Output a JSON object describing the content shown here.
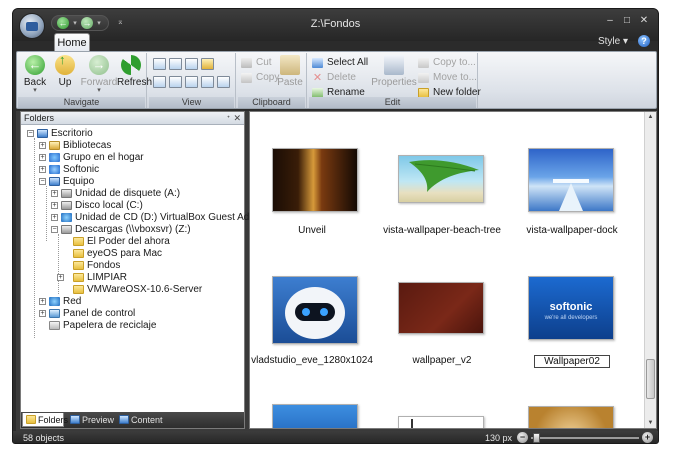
{
  "window": {
    "title": "Z:\\Fondos",
    "minimize_glyph": "‒",
    "maximize_glyph": "□",
    "close_glyph": "✕"
  },
  "qat": {
    "back_glyph": "←",
    "forward_glyph": "→",
    "more_glyph": "⌅"
  },
  "tabs": {
    "home": "Home",
    "style_menu": "Style ▾",
    "help_glyph": "?"
  },
  "ribbon": {
    "navigate": {
      "label": "Navigate",
      "back": "Back",
      "up": "Up",
      "forward": "Forward",
      "refresh": "Refresh"
    },
    "view": {
      "label": "View"
    },
    "clipboard": {
      "label": "Clipboard",
      "cut": "Cut",
      "copy": "Copy",
      "paste": "Paste"
    },
    "edit": {
      "label": "Edit",
      "select_all": "Select All",
      "delete": "Delete",
      "rename": "Rename",
      "properties": "Properties",
      "copy_to": "Copy to...",
      "move_to": "Move to...",
      "new_folder": "New folder"
    }
  },
  "folders_pane": {
    "title": "Folders",
    "pin_glyph": "ᐩ",
    "close_glyph": "✕",
    "tree": [
      {
        "label": "Escritorio",
        "icon": "desktop-icon",
        "exp": "−"
      },
      {
        "label": "Bibliotecas",
        "icon": "library-icon",
        "exp": "+"
      },
      {
        "label": "Grupo en el hogar",
        "icon": "homegroup-icon",
        "exp": "+"
      },
      {
        "label": "Softonic",
        "icon": "user-icon",
        "exp": "+"
      },
      {
        "label": "Equipo",
        "icon": "computer-icon",
        "exp": "−"
      },
      {
        "label": "Unidad de disquete (A:)",
        "icon": "floppy-icon",
        "exp": "+"
      },
      {
        "label": "Disco local (C:)",
        "icon": "drive-icon",
        "exp": "+"
      },
      {
        "label": "Unidad de CD (D:) VirtualBox Guest Additions",
        "icon": "cd-icon",
        "exp": "+"
      },
      {
        "label": "Descargas (\\\\vboxsvr) (Z:)",
        "icon": "network-drive-icon",
        "exp": "−"
      },
      {
        "label": "El Poder del ahora",
        "icon": "folder-icon",
        "exp": ""
      },
      {
        "label": "eyeOS para Mac",
        "icon": "folder-icon",
        "exp": ""
      },
      {
        "label": "Fondos",
        "icon": "folder-icon",
        "exp": ""
      },
      {
        "label": "LIMPIAR",
        "icon": "folder-icon",
        "exp": "+"
      },
      {
        "label": "VMWareOSX-10.6-Server",
        "icon": "folder-icon",
        "exp": ""
      },
      {
        "label": "Red",
        "icon": "network-icon",
        "exp": "+"
      },
      {
        "label": "Panel de control",
        "icon": "control-panel-icon",
        "exp": "+"
      },
      {
        "label": "Papelera de reciclaje",
        "icon": "recycle-bin-icon",
        "exp": ""
      }
    ],
    "tabs": {
      "folders": "Folders",
      "preview": "Preview",
      "content": "Content"
    }
  },
  "files": [
    {
      "name": "Unveil"
    },
    {
      "name": "vista-wallpaper-beach-tree"
    },
    {
      "name": "vista-wallpaper-dock"
    },
    {
      "name": "vladstudio_eve_1280x1024"
    },
    {
      "name": "wallpaper_v2"
    },
    {
      "name": "Wallpaper02",
      "renaming": true
    },
    {
      "name": ""
    },
    {
      "name": ""
    },
    {
      "name": ""
    }
  ],
  "thumbnail_art": {
    "softonic_logo": "softonic",
    "softonic_tagline": "we're all developers"
  },
  "status": {
    "objects": "58 objects",
    "zoom": "130 px",
    "zoom_out_glyph": "−",
    "zoom_in_glyph": "+",
    "zoom_level": 0.05
  },
  "colors": {
    "chrome_dark": "#2b2b2b",
    "accent_blue": "#1d5fc4",
    "ribbon_light": "#dde2e9"
  }
}
